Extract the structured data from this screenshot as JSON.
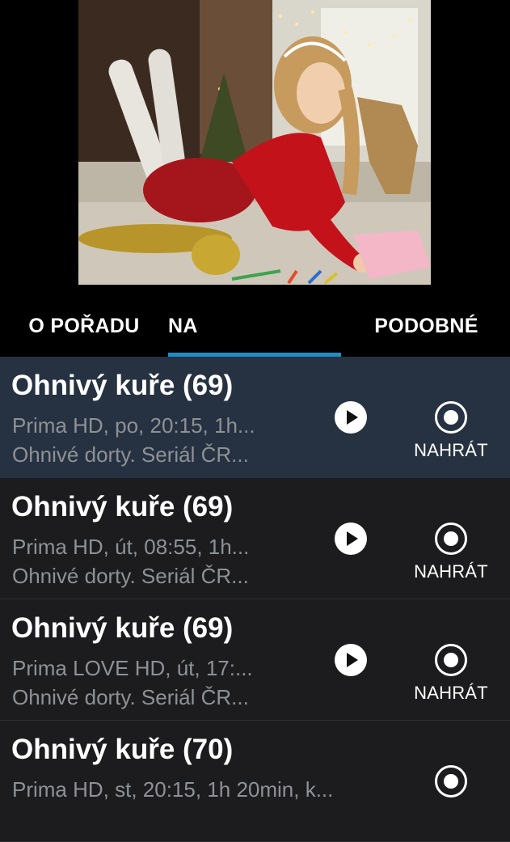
{
  "video": {
    "description_icon": "video-thumbnail"
  },
  "tabs": {
    "about": "O POŘADU",
    "on": "NA",
    "similar": "PODOBNÉ"
  },
  "episodes": [
    {
      "title": "Ohnivý kuře (69)",
      "line1": "Prima HD, po, 20:15, 1h...",
      "line2": "Ohnivé dorty. Seriál ČR...",
      "record_label": "NAHRÁT",
      "selected": true
    },
    {
      "title": "Ohnivý kuře (69)",
      "line1": "Prima HD, út, 08:55, 1h...",
      "line2": "Ohnivé dorty. Seriál ČR...",
      "record_label": "NAHRÁT",
      "selected": false
    },
    {
      "title": "Ohnivý kuře (69)",
      "line1": "Prima LOVE HD, út, 17:...",
      "line2": "Ohnivé dorty. Seriál ČR...",
      "record_label": "NAHRÁT",
      "selected": false
    },
    {
      "title": "Ohnivý kuře (70)",
      "line1": "Prima HD, st, 20:15, 1h 20min, k...",
      "line2": "",
      "record_label": "",
      "selected": false
    }
  ],
  "colors": {
    "accent": "#1e8ec7",
    "selected_row": "#263241",
    "row_bg": "#1c1c1e",
    "secondary_text": "#8e9196"
  }
}
